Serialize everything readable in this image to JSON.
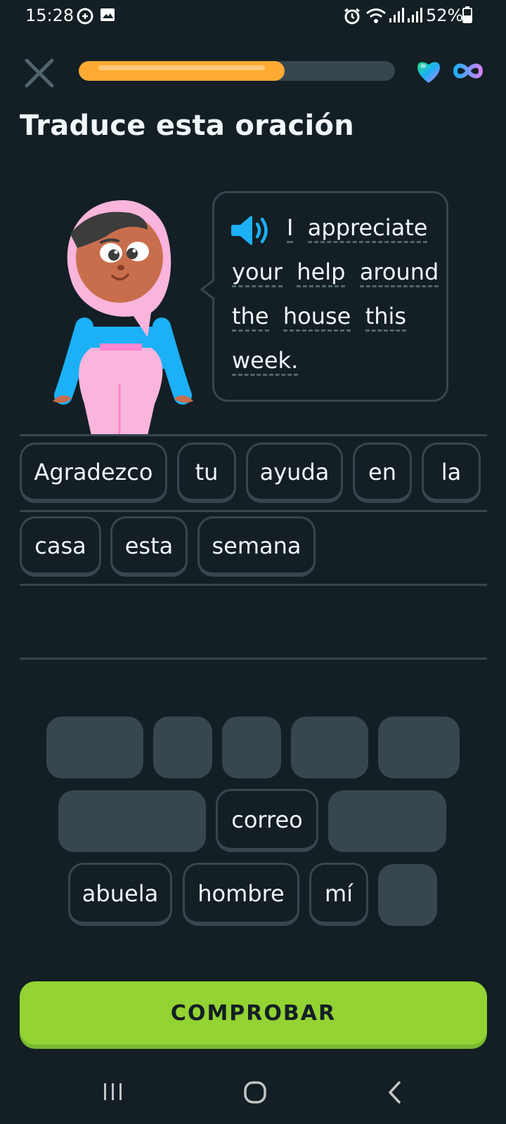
{
  "status_bar": {
    "time": "15:28",
    "battery": "52%"
  },
  "header": {
    "progress_fraction": 0.65
  },
  "page_title": "Traduce esta oración",
  "prompt": {
    "lines": [
      [
        "I",
        "appreciate"
      ],
      [
        "your",
        "help",
        "around"
      ],
      [
        "the",
        "house",
        "this"
      ],
      [
        "week."
      ]
    ]
  },
  "answer": {
    "row1": [
      "Agradezco",
      "tu",
      "ayuda",
      "en",
      "la"
    ],
    "row2": [
      "casa",
      "esta",
      "semana"
    ]
  },
  "word_bank": {
    "correo": "correo",
    "abuela": "abuela",
    "hombre": "hombre",
    "mi": "mí"
  },
  "check_button": "COMPROBAR",
  "colors": {
    "background": "#131f24",
    "border": "#37464f",
    "progress": "#ffab33",
    "check": "#93d333",
    "speaker": "#1cb0f6"
  }
}
